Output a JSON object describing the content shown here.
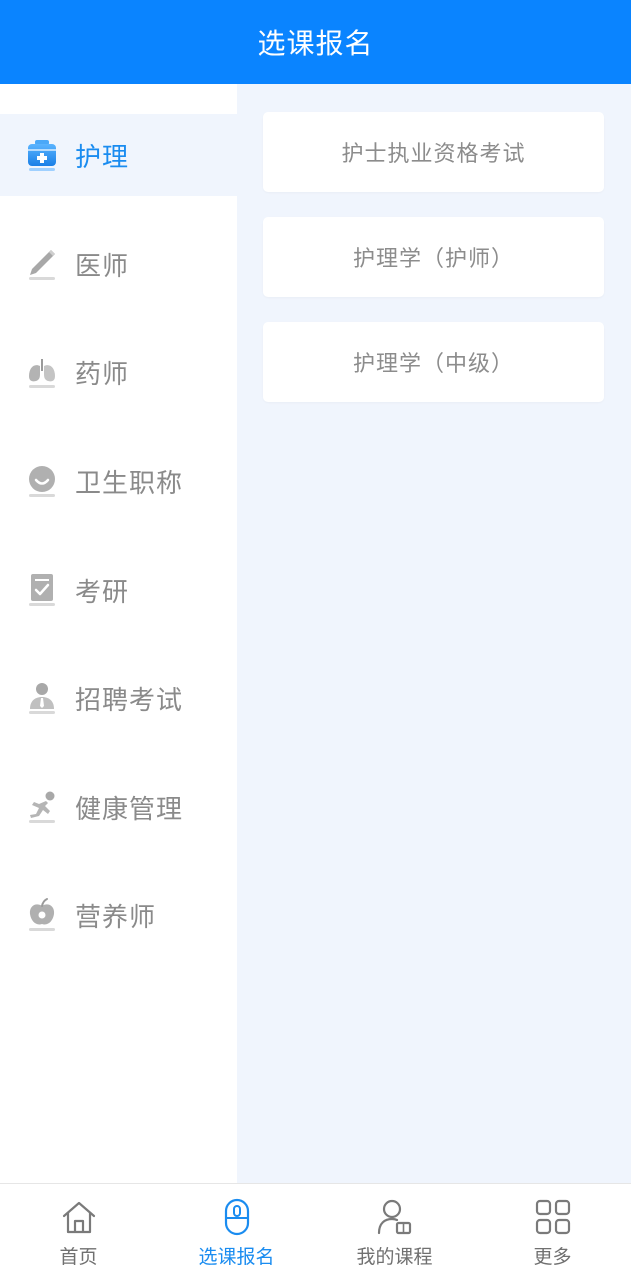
{
  "header": {
    "title": "选课报名"
  },
  "sidebar": {
    "items": [
      {
        "label": "护理",
        "icon": "nursing-kit-icon",
        "active": true
      },
      {
        "label": "医师",
        "icon": "scalpel-icon",
        "active": false
      },
      {
        "label": "药师",
        "icon": "lungs-icon",
        "active": false
      },
      {
        "label": "卫生职称",
        "icon": "face-icon",
        "active": false
      },
      {
        "label": "考研",
        "icon": "checklist-icon",
        "active": false
      },
      {
        "label": "招聘考试",
        "icon": "person-tie-icon",
        "active": false
      },
      {
        "label": "健康管理",
        "icon": "runner-icon",
        "active": false
      },
      {
        "label": "营养师",
        "icon": "apple-icon",
        "active": false
      }
    ]
  },
  "courses": [
    {
      "label": "护士执业资格考试"
    },
    {
      "label": "护理学（护师）"
    },
    {
      "label": "护理学（中级）"
    }
  ],
  "tabbar": {
    "tabs": [
      {
        "label": "首页",
        "icon": "home-icon",
        "active": false
      },
      {
        "label": "选课报名",
        "icon": "mouse-icon",
        "active": true
      },
      {
        "label": "我的课程",
        "icon": "user-book-icon",
        "active": false
      },
      {
        "label": "更多",
        "icon": "grid-icon",
        "active": false
      }
    ]
  },
  "colors": {
    "brand": "#0a84ff",
    "active_text": "#1a8cf0",
    "content_bg": "#f0f5fd",
    "inactive_text": "#8a8a8a"
  }
}
